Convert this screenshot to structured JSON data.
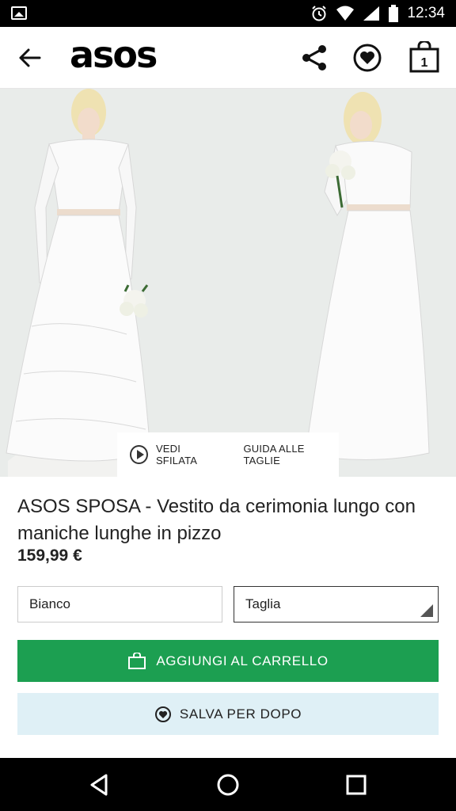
{
  "status_bar": {
    "time": "12:34",
    "icons": [
      "gallery-icon",
      "alarm-icon",
      "wifi-icon",
      "signal-icon",
      "battery-icon"
    ]
  },
  "header": {
    "logo": "asos",
    "cart_count": "1",
    "icons": [
      "back-arrow-icon",
      "share-icon",
      "heart-icon",
      "shopping-bag-icon"
    ]
  },
  "gallery": {
    "video_label": "VEDI SFILATA",
    "size_guide_label": "GUIDA ALLE TAGLIE"
  },
  "product": {
    "title": "ASOS SPOSA - Vestito da cerimonia lungo con maniche lunghe in pizzo",
    "price": "159,99 €"
  },
  "options": {
    "color_value": "Bianco",
    "size_placeholder": "Taglia"
  },
  "actions": {
    "add_to_cart": "AGGIUNGI AL CARRELLO",
    "save_for_later": "SALVA PER DOPO"
  },
  "colors": {
    "accent_green": "#1c9f51",
    "save_bg": "#dff0f6"
  }
}
